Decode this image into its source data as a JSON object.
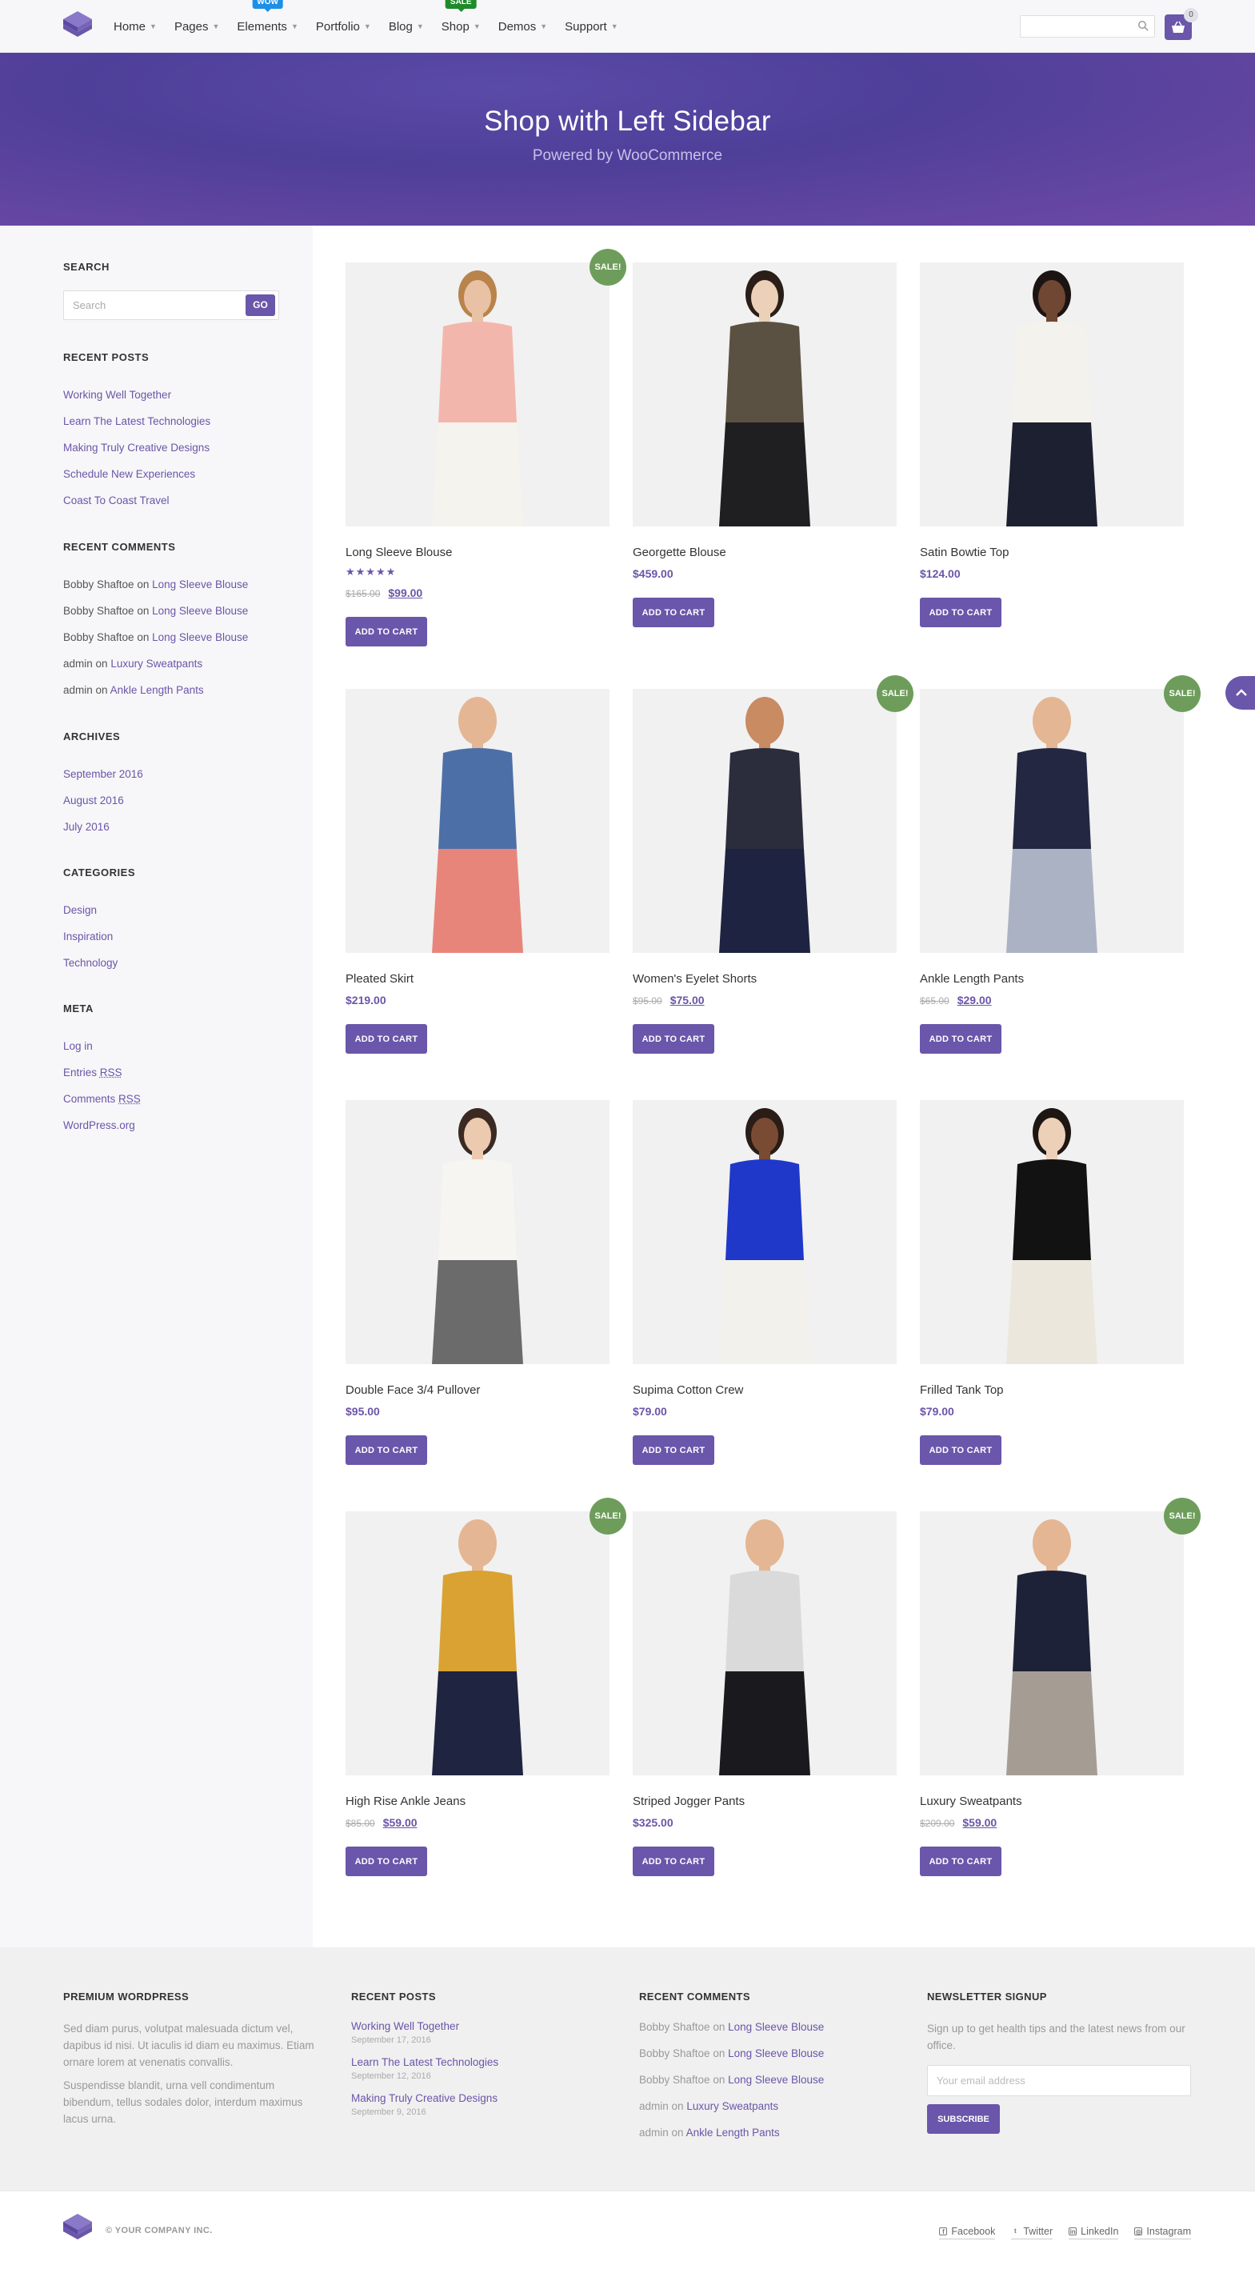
{
  "header": {
    "nav": [
      {
        "label": "Home"
      },
      {
        "label": "Pages"
      },
      {
        "label": "Elements",
        "badge": "WOW"
      },
      {
        "label": "Portfolio"
      },
      {
        "label": "Blog"
      },
      {
        "label": "Shop",
        "badge": "SALE"
      },
      {
        "label": "Demos"
      },
      {
        "label": "Support"
      }
    ],
    "cart_count": "0"
  },
  "hero": {
    "title": "Shop with Left Sidebar",
    "subtitle": "Powered by WooCommerce"
  },
  "sidebar": {
    "search": {
      "title": "SEARCH",
      "placeholder": "Search",
      "button": "GO"
    },
    "recent_posts": {
      "title": "RECENT POSTS",
      "items": [
        "Working Well Together",
        "Learn The Latest Technologies",
        "Making Truly Creative Designs",
        "Schedule New Experiences",
        "Coast To Coast Travel"
      ]
    },
    "recent_comments": {
      "title": "RECENT COMMENTS",
      "items": [
        {
          "author": "Bobby Shaftoe",
          "on": "on",
          "post": "Long Sleeve Blouse"
        },
        {
          "author": "Bobby Shaftoe",
          "on": "on",
          "post": "Long Sleeve Blouse"
        },
        {
          "author": "Bobby Shaftoe",
          "on": "on",
          "post": "Long Sleeve Blouse"
        },
        {
          "author": "admin",
          "on": "on",
          "post": "Luxury Sweatpants"
        },
        {
          "author": "admin",
          "on": "on",
          "post": "Ankle Length Pants"
        }
      ]
    },
    "archives": {
      "title": "ARCHIVES",
      "items": [
        "September 2016",
        "August 2016",
        "July 2016"
      ]
    },
    "categories": {
      "title": "CATEGORIES",
      "items": [
        "Design",
        "Inspiration",
        "Technology"
      ]
    },
    "meta": {
      "title": "META",
      "log_in": "Log in",
      "entries": "Entries",
      "comments": "Comments",
      "rss": "RSS",
      "wordpress": "WordPress.org"
    }
  },
  "products": [
    {
      "title": "Long Sleeve Blouse",
      "old_price": "$165.00",
      "price": "$99.00",
      "sale": true,
      "rating": 5,
      "button": "ADD TO CART",
      "top_color": "#f3b6ad",
      "bottom_color": "#f5f3ee",
      "skin": "#e9c2a6",
      "hair": "#b8844b"
    },
    {
      "title": "Georgette Blouse",
      "old_price": "",
      "price": "$459.00",
      "sale": false,
      "rating": 0,
      "button": "ADD TO CART",
      "top_color": "#5b5142",
      "bottom_color": "#1f1f22",
      "skin": "#ecd0b8",
      "hair": "#2a1e18"
    },
    {
      "title": "Satin Bowtie Top",
      "old_price": "",
      "price": "$124.00",
      "sale": false,
      "rating": 0,
      "button": "ADD TO CART",
      "top_color": "#f4f2ec",
      "bottom_color": "#1c2030",
      "skin": "#6f4732",
      "hair": "#1b1412"
    },
    {
      "title": "Pleated Skirt",
      "old_price": "",
      "price": "$219.00",
      "sale": false,
      "rating": 0,
      "button": "ADD TO CART",
      "top_color": "#4d6fa8",
      "bottom_color": "#e8857a",
      "skin": "#e5b693",
      "hair": "#e5b693"
    },
    {
      "title": "Women's Eyelet Shorts",
      "old_price": "$95.00",
      "price": "$75.00",
      "sale": true,
      "rating": 0,
      "button": "ADD TO CART",
      "top_color": "#2b2d3c",
      "bottom_color": "#1d2340",
      "skin": "#c98b62",
      "hair": "#c98b62"
    },
    {
      "title": "Ankle Length Pants",
      "old_price": "$65.00",
      "price": "$29.00",
      "sale": true,
      "rating": 0,
      "button": "ADD TO CART",
      "top_color": "#232742",
      "bottom_color": "#aab2c4",
      "skin": "#e5b693",
      "hair": "#e5b693"
    },
    {
      "title": "Double Face 3/4 Pullover",
      "old_price": "",
      "price": "$95.00",
      "sale": false,
      "rating": 0,
      "button": "ADD TO CART",
      "top_color": "#f6f5f2",
      "bottom_color": "#6b6b6b",
      "skin": "#eccab0",
      "hair": "#3a2a22"
    },
    {
      "title": "Supima Cotton Crew",
      "old_price": "",
      "price": "$79.00",
      "sale": false,
      "rating": 0,
      "button": "ADD TO CART",
      "top_color": "#1f38c9",
      "bottom_color": "#f3f1ec",
      "skin": "#7a4b33",
      "hair": "#2a1c16"
    },
    {
      "title": "Frilled Tank Top",
      "old_price": "",
      "price": "$79.00",
      "sale": false,
      "rating": 0,
      "button": "ADD TO CART",
      "top_color": "#121212",
      "bottom_color": "#ebe7dd",
      "skin": "#ecd0b8",
      "hair": "#1e1612"
    },
    {
      "title": "High Rise Ankle Jeans",
      "old_price": "$85.00",
      "price": "$59.00",
      "sale": true,
      "rating": 0,
      "button": "ADD TO CART",
      "top_color": "#d9a233",
      "bottom_color": "#1f2540",
      "skin": "#e5b693",
      "hair": "#e5b693"
    },
    {
      "title": "Striped Jogger Pants",
      "old_price": "",
      "price": "$325.00",
      "sale": false,
      "rating": 0,
      "button": "ADD TO CART",
      "top_color": "#dadada",
      "bottom_color": "#1a1a1e",
      "skin": "#e5b693",
      "hair": "#e5b693"
    },
    {
      "title": "Luxury Sweatpants",
      "old_price": "$209.00",
      "price": "$59.00",
      "sale": true,
      "rating": 0,
      "button": "ADD TO CART",
      "top_color": "#1d2238",
      "bottom_color": "#a59d94",
      "skin": "#e5b693",
      "hair": "#e5b693"
    }
  ],
  "sale_label": "SALE!",
  "footer": {
    "about": {
      "title": "PREMIUM WORDPRESS",
      "p1": "Sed diam purus, volutpat malesuada dictum vel, dapibus id nisi. Ut iaculis id diam eu maximus. Etiam ornare lorem at venenatis convallis.",
      "p2": "Suspendisse blandit, urna vell condimentum bibendum, tellus sodales dolor, interdum maximus lacus urna."
    },
    "recent_posts": {
      "title": "RECENT POSTS",
      "items": [
        {
          "title": "Working Well Together",
          "date": "September 17, 2016"
        },
        {
          "title": "Learn The Latest Technologies",
          "date": "September 12, 2016"
        },
        {
          "title": "Making Truly Creative Designs",
          "date": "September 9, 2016"
        }
      ]
    },
    "recent_comments": {
      "title": "RECENT COMMENTS",
      "items": [
        {
          "author": "Bobby Shaftoe",
          "on": "on",
          "post": "Long Sleeve Blouse"
        },
        {
          "author": "Bobby Shaftoe",
          "on": "on",
          "post": "Long Sleeve Blouse"
        },
        {
          "author": "Bobby Shaftoe",
          "on": "on",
          "post": "Long Sleeve Blouse"
        },
        {
          "author": "admin",
          "on": "on",
          "post": "Luxury Sweatpants"
        },
        {
          "author": "admin",
          "on": "on",
          "post": "Ankle Length Pants"
        }
      ]
    },
    "newsletter": {
      "title": "NEWSLETTER SIGNUP",
      "text": "Sign up to get health tips and the latest news from our office.",
      "placeholder": "Your email address",
      "button": "SUBSCRIBE"
    },
    "copyright": "© YOUR COMPANY INC.",
    "social": [
      {
        "label": "Facebook",
        "icon": "facebook-icon",
        "glyph": "f"
      },
      {
        "label": "Twitter",
        "icon": "twitter-icon",
        "glyph": "t"
      },
      {
        "label": "LinkedIn",
        "icon": "linkedin-icon",
        "glyph": "in"
      },
      {
        "label": "Instagram",
        "icon": "instagram-icon",
        "glyph": "◎"
      }
    ]
  },
  "colors": {
    "accent": "#6a56aa",
    "sale_badge": "#6e9d5b",
    "wow_badge": "#1e8fe6",
    "sale_nav_badge": "#1f8a2a"
  }
}
